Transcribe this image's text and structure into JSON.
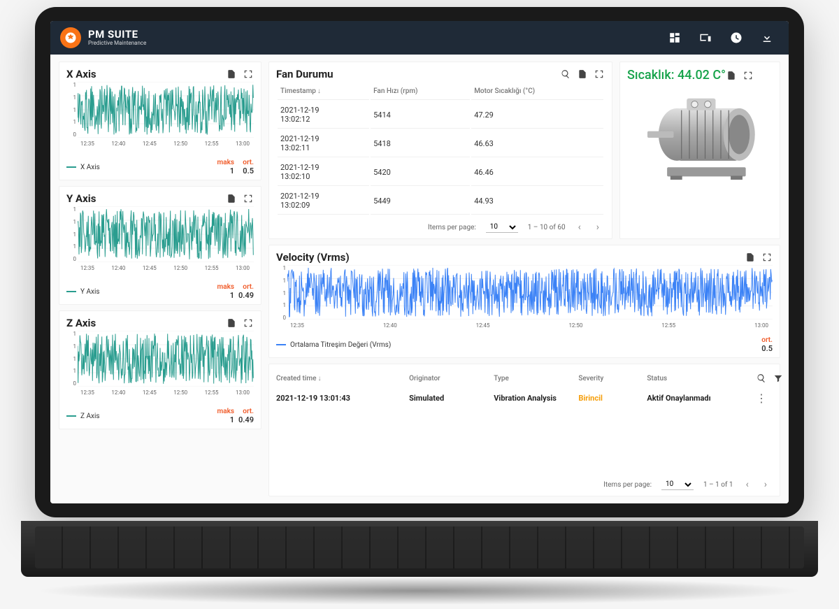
{
  "app": {
    "title": "PM SUITE",
    "subtitle": "Predictive Maintenance"
  },
  "topbar_icons": [
    "dashboard-icon",
    "devices-icon",
    "clock-icon",
    "download-icon"
  ],
  "charts": {
    "x_ticks": [
      "12:35",
      "12:40",
      "12:45",
      "12:50",
      "12:55",
      "13:00"
    ],
    "y_ticks": [
      "1",
      "1",
      "1",
      "1",
      "0"
    ],
    "stat_maks_label": "maks",
    "stat_ort_label": "ort.",
    "x_axis": {
      "title": "X Axis",
      "legend": "X Axis",
      "color": "#2a9d8f",
      "maks": "1",
      "ort": "0.5"
    },
    "y_axis": {
      "title": "Y Axis",
      "legend": "Y Axis",
      "color": "#2a9d8f",
      "maks": "1",
      "ort": "0.49"
    },
    "z_axis": {
      "title": "Z Axis",
      "legend": "Z Axis",
      "color": "#2a9d8f",
      "maks": "1",
      "ort": "0.49"
    },
    "velocity": {
      "title": "Velocity (Vrms)",
      "legend": "Ortalama Titreşim Değeri (Vrms)",
      "color": "#3b82f6",
      "ort": "0.5"
    }
  },
  "fan": {
    "title": "Fan Durumu",
    "columns": [
      "Timestamp",
      "Fan Hızı (rpm)",
      "Motor Sıcaklığı (°C)"
    ],
    "rows": [
      {
        "ts": "2021-12-19 13:02:12",
        "rpm": "5414",
        "temp": "47.29"
      },
      {
        "ts": "2021-12-19 13:02:11",
        "rpm": "5418",
        "temp": "46.63"
      },
      {
        "ts": "2021-12-19 13:02:10",
        "rpm": "5420",
        "temp": "46.46"
      },
      {
        "ts": "2021-12-19 13:02:09",
        "rpm": "5449",
        "temp": "44.93"
      }
    ],
    "pager": {
      "items_label": "Items per page:",
      "size": "10",
      "range": "1 – 10 of 60"
    }
  },
  "temp_card": {
    "title": "Sıcaklık: 44.02 C°"
  },
  "alarms": {
    "columns": {
      "created": "Created time",
      "originator": "Originator",
      "type": "Type",
      "severity": "Severity",
      "status": "Status"
    },
    "row": {
      "created": "2021-12-19 13:01:43",
      "originator": "Simulated",
      "type": "Vibration Analysis",
      "severity": "Birincil",
      "status": "Aktif Onaylanmadı"
    },
    "pager": {
      "items_label": "Items per page:",
      "size": "10",
      "range": "1 – 1 of 1"
    }
  },
  "chart_data": [
    {
      "type": "line",
      "title": "X Axis",
      "x_ticks": [
        "12:35",
        "12:40",
        "12:45",
        "12:50",
        "12:55",
        "13:00"
      ],
      "ylim": [
        0,
        1
      ],
      "series": [
        {
          "name": "X Axis",
          "color": "#2a9d8f",
          "stats": {
            "maks": 1,
            "ort": 0.5
          },
          "note": "dense noise ~0–1"
        }
      ]
    },
    {
      "type": "line",
      "title": "Y Axis",
      "x_ticks": [
        "12:35",
        "12:40",
        "12:45",
        "12:50",
        "12:55",
        "13:00"
      ],
      "ylim": [
        0,
        1
      ],
      "series": [
        {
          "name": "Y Axis",
          "color": "#2a9d8f",
          "stats": {
            "maks": 1,
            "ort": 0.49
          },
          "note": "dense noise ~0–1"
        }
      ]
    },
    {
      "type": "line",
      "title": "Z Axis",
      "x_ticks": [
        "12:35",
        "12:40",
        "12:45",
        "12:50",
        "12:55",
        "13:00"
      ],
      "ylim": [
        0,
        1
      ],
      "series": [
        {
          "name": "Z Axis",
          "color": "#2a9d8f",
          "stats": {
            "maks": 1,
            "ort": 0.49
          },
          "note": "dense noise ~0–1"
        }
      ]
    },
    {
      "type": "line",
      "title": "Velocity (Vrms)",
      "x_ticks": [
        "12:35",
        "12:40",
        "12:45",
        "12:50",
        "12:55",
        "13:00"
      ],
      "ylim": [
        0,
        1
      ],
      "series": [
        {
          "name": "Ortalama Titreşim Değeri (Vrms)",
          "color": "#3b82f6",
          "stats": {
            "ort": 0.5
          },
          "note": "dense noise ~0–1"
        }
      ]
    }
  ]
}
